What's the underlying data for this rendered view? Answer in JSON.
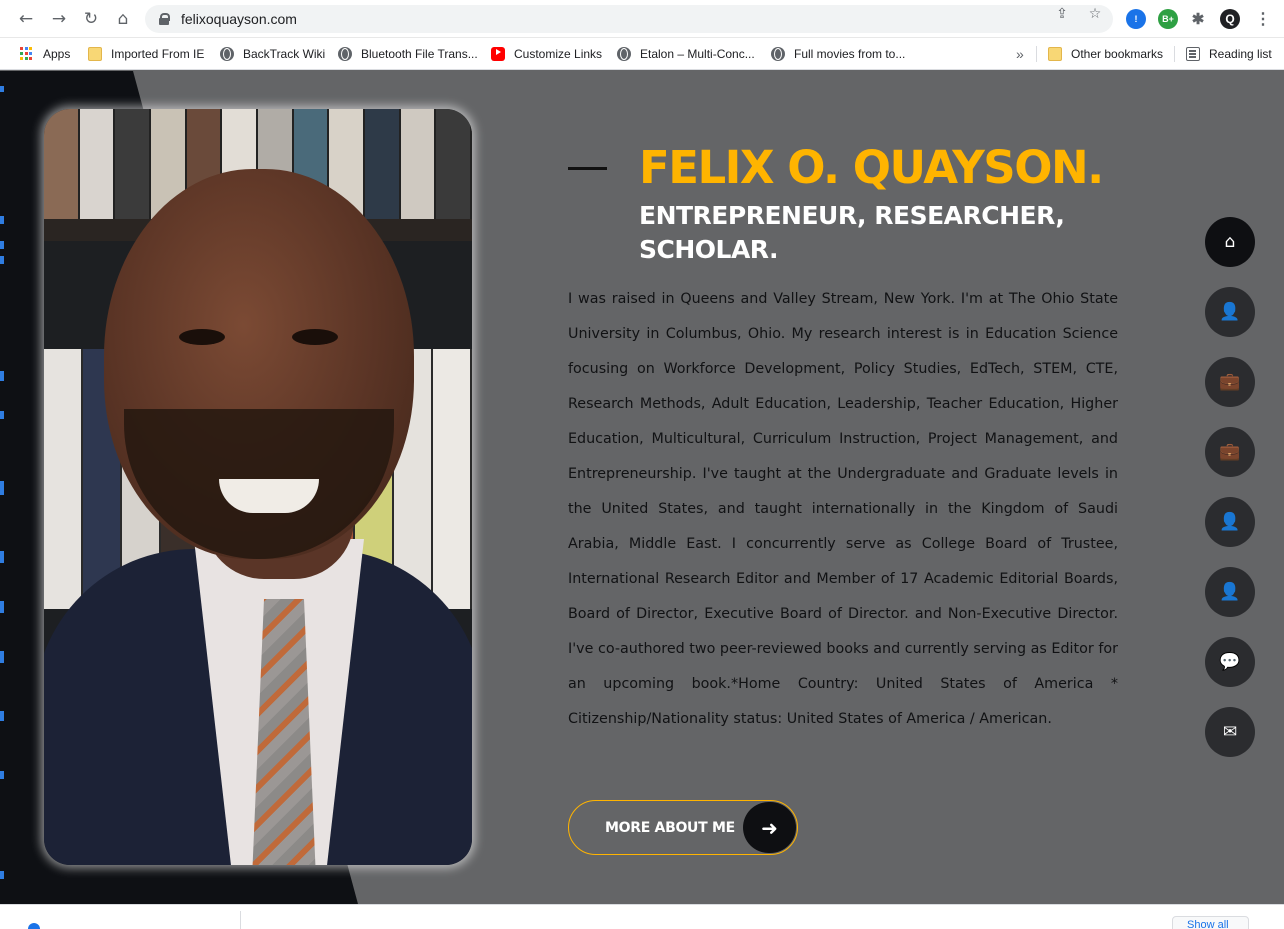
{
  "browser": {
    "url": "felixoquayson.com",
    "bookmarks": [
      {
        "label": "Apps",
        "icon": "apps-grid-icon"
      },
      {
        "label": "Imported From IE",
        "icon": "folder-icon"
      },
      {
        "label": "BackTrack Wiki",
        "icon": "globe-icon"
      },
      {
        "label": "Bluetooth File Trans...",
        "icon": "globe-icon"
      },
      {
        "label": "Customize Links",
        "icon": "youtube-icon"
      },
      {
        "label": "Etalon – Multi-Conc...",
        "icon": "globe-icon"
      },
      {
        "label": "Full movies from to...",
        "icon": "globe-icon"
      }
    ],
    "overflow_label": "»",
    "other_bookmarks": "Other bookmarks",
    "reading_list": "Reading list",
    "extensions": [
      {
        "name": "translate-extension-icon",
        "text": "!"
      },
      {
        "name": "bplus-extension-icon",
        "text": "B+"
      },
      {
        "name": "puzzle-extensions-icon",
        "text": "✱"
      },
      {
        "name": "profile-avatar-icon",
        "text": "Q"
      },
      {
        "name": "menu-kebab-icon",
        "text": "⋮"
      }
    ]
  },
  "hero": {
    "name": "FELIX O. QUAYSON.",
    "subtitle": "ENTREPRENEUR, RESEARCHER, SCHOLAR.",
    "bio": "I was raised in Queens and Valley Stream, New York. I'm at The Ohio State University in Columbus, Ohio. My research interest is in Education Science focusing on Workforce Development, Policy Studies, EdTech, STEM, CTE, Research Methods, Adult Education, Leadership, Teacher Education, Higher Education, Multicultural, Curriculum Instruction, Project Management, and Entrepreneurship. I've taught at the Undergraduate and Graduate levels in the United States, and taught internationally in the Kingdom of Saudi Arabia, Middle East. I concurrently serve as College Board of Trustee, International Research Editor and Member of 17 Academic Editorial Boards, Board of Director, Executive Board of Director. and Non-Executive Director. I've co-authored two peer-reviewed books and currently serving as Editor for an upcoming book.*Home Country: United States of America * Citizenship/Nationality status: United States of America / American.",
    "button_label": "MORE ABOUT ME",
    "button_icon": "arrow-right-icon"
  },
  "side_nav": [
    {
      "name": "home",
      "icon": "home-icon",
      "glyph": "⌂",
      "active": true
    },
    {
      "name": "about",
      "icon": "user-icon",
      "glyph": "👤",
      "active": false
    },
    {
      "name": "resume",
      "icon": "briefcase-icon",
      "glyph": "💼",
      "active": false
    },
    {
      "name": "portfolio",
      "icon": "briefcase-icon",
      "glyph": "💼",
      "active": false
    },
    {
      "name": "profile-2",
      "icon": "user-icon",
      "glyph": "👤",
      "active": false
    },
    {
      "name": "profile-3",
      "icon": "user-icon",
      "glyph": "👤",
      "active": false
    },
    {
      "name": "testimonials",
      "icon": "chat-icon",
      "glyph": "💬",
      "active": false
    },
    {
      "name": "contact",
      "icon": "envelope-open-icon",
      "glyph": "✉",
      "active": false
    }
  ],
  "colors": {
    "accent": "#ffb400",
    "page_bg": "#646567",
    "dark": "#0e1014"
  },
  "download_bar": {
    "show_all": "Show all"
  }
}
